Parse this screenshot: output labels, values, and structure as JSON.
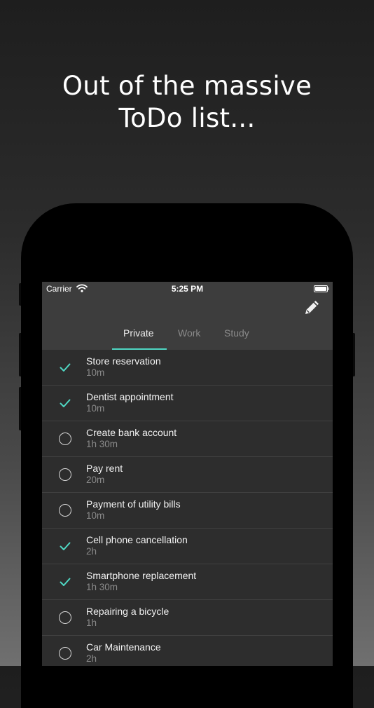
{
  "headline": {
    "line1": "Out of the massive",
    "line2": "ToDo list..."
  },
  "status_bar": {
    "carrier": "Carrier",
    "time": "5:25 PM"
  },
  "toolbar": {
    "edit_icon": "pencil-icon"
  },
  "tabs": [
    {
      "label": "Private",
      "active": true
    },
    {
      "label": "Work",
      "active": false
    },
    {
      "label": "Study",
      "active": false
    }
  ],
  "colors": {
    "accent": "#4fd8c4",
    "header_bg": "#3d3d3d",
    "list_bg": "#2d2d2d"
  },
  "tasks": [
    {
      "title": "Store reservation",
      "duration": "10m",
      "done": true
    },
    {
      "title": "Dentist appointment",
      "duration": "10m",
      "done": true
    },
    {
      "title": "Create bank account",
      "duration": "1h 30m",
      "done": false
    },
    {
      "title": "Pay rent",
      "duration": "20m",
      "done": false
    },
    {
      "title": "Payment of utility bills",
      "duration": "10m",
      "done": false
    },
    {
      "title": "Cell phone cancellation",
      "duration": "2h",
      "done": true
    },
    {
      "title": "Smartphone replacement",
      "duration": "1h 30m",
      "done": true
    },
    {
      "title": "Repairing a bicycle",
      "duration": "1h",
      "done": false
    },
    {
      "title": "Car Maintenance",
      "duration": "2h",
      "done": false
    }
  ]
}
